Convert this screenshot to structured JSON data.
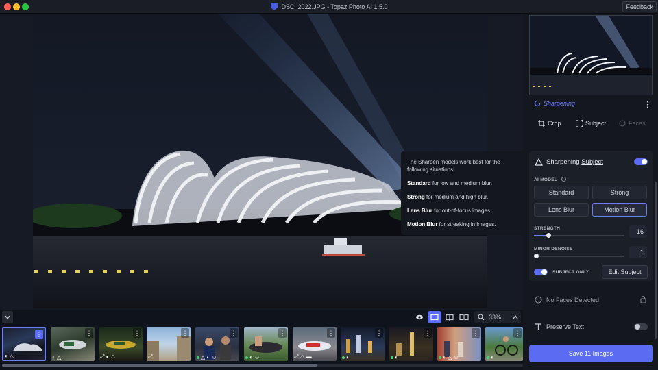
{
  "window": {
    "title": "DSC_2022.JPG - Topaz Photo AI 1.5.0",
    "feedback_label": "Feedback"
  },
  "tooltip": {
    "intro": "The Sharpen models work best for the following situations:",
    "items": [
      {
        "name": "Standard",
        "desc": " for low and medium blur."
      },
      {
        "name": "Strong",
        "desc": " for medium and high blur."
      },
      {
        "name": "Lens Blur",
        "desc": " for out-of-focus images."
      },
      {
        "name": "Motion Blur",
        "desc": " for streaking in images."
      }
    ]
  },
  "viewer": {
    "zoom": "33%"
  },
  "filmstrip": {
    "count": 11
  },
  "panel": {
    "status": "Sharpening",
    "tools": {
      "crop": "Crop",
      "subject": "Subject",
      "faces": "Faces"
    },
    "sharpen": {
      "title": "Sharpening",
      "subject_link": "Subject",
      "enabled": true,
      "ai_model_label": "AI MODEL",
      "models": [
        "Standard",
        "Strong",
        "Lens Blur",
        "Motion Blur"
      ],
      "selected_model": "Motion Blur",
      "strength_label": "STRENGTH",
      "strength_value": "16",
      "strength_fraction": 0.16,
      "denoise_label": "MINOR DENOISE",
      "denoise_value": "1",
      "denoise_fraction": 0.01,
      "subject_only_label": "SUBJECT ONLY",
      "subject_only": true,
      "edit_subject_label": "Edit Subject"
    },
    "faces": {
      "label": "No Faces Detected"
    },
    "text": {
      "label": "Preserve Text",
      "enabled": false
    },
    "save_label": "Save 11 Images"
  },
  "colors": {
    "accent": "#5b6cf2",
    "bg": "#0f131c",
    "panel": "#14171e"
  }
}
